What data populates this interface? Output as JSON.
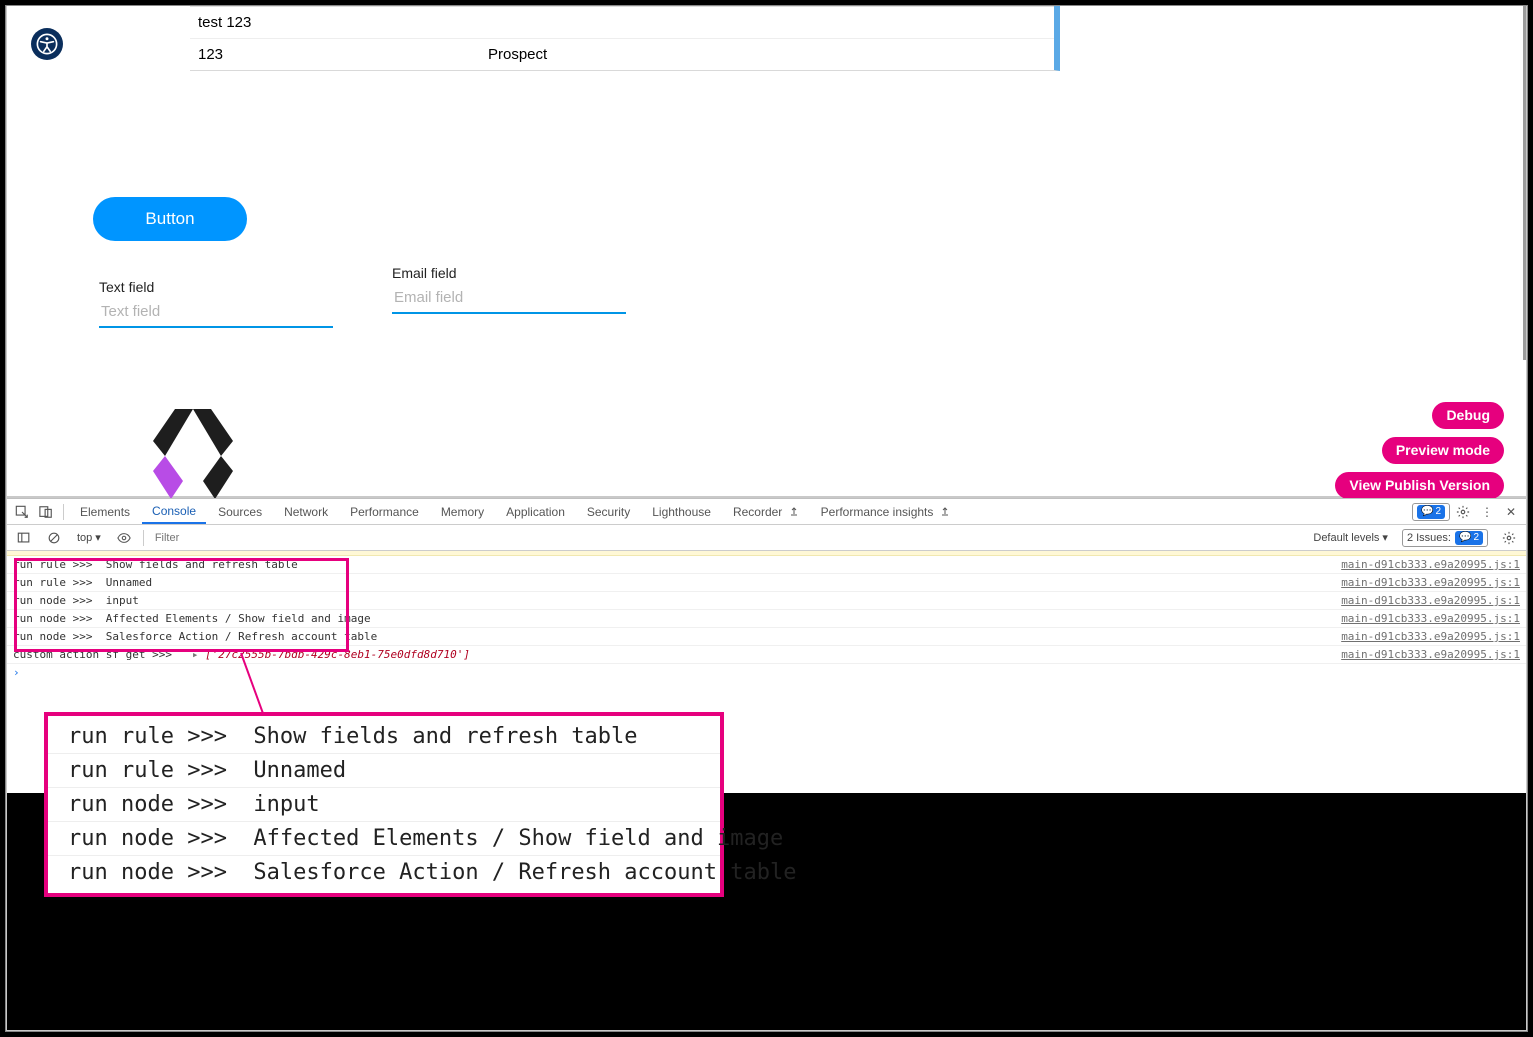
{
  "table": {
    "rows": [
      {
        "name": "test 123",
        "type": ""
      },
      {
        "name": "123",
        "type": "Prospect"
      }
    ]
  },
  "button": {
    "label": "Button"
  },
  "fields": {
    "text": {
      "label": "Text field",
      "placeholder": "Text field"
    },
    "email": {
      "label": "Email field",
      "placeholder": "Email field"
    }
  },
  "side": {
    "debug": "Debug",
    "preview": "Preview mode",
    "publish": "View Publish Version"
  },
  "devtools": {
    "tabs": {
      "elements": "Elements",
      "console": "Console",
      "sources": "Sources",
      "network": "Network",
      "performance": "Performance",
      "memory": "Memory",
      "application": "Application",
      "security": "Security",
      "lighthouse": "Lighthouse",
      "recorder": "Recorder",
      "perf_insights": "Performance insights"
    },
    "errors_badge": "2",
    "toolbar": {
      "context": "top",
      "filter_placeholder": "Filter",
      "levels": "Default levels",
      "issues_label": "2 Issues:",
      "issues_count": "2"
    },
    "source_link": "main-d91cb333.e9a20995.js:1",
    "logs": [
      "run rule >>>  Show fields and refresh table",
      "run rule >>>  Unnamed",
      "run node >>>  input",
      "run node >>>  Affected Elements / Show field and image",
      "run node >>>  Salesforce Action / Refresh account table"
    ],
    "custom_action_prefix": "custom action sf get >>>   ",
    "custom_action_arrow": "▸",
    "custom_action_value": "['27c2555b-7bdb-429c-8eb1-75e0dfd8d710']"
  },
  "zoom": {
    "rows": [
      "run rule >>>  Show fields and refresh table",
      "run rule >>>  Unnamed",
      "run node >>>  input",
      "run node >>>  Affected Elements / Show field and image",
      "run node >>>  Salesforce Action / Refresh account table"
    ]
  }
}
